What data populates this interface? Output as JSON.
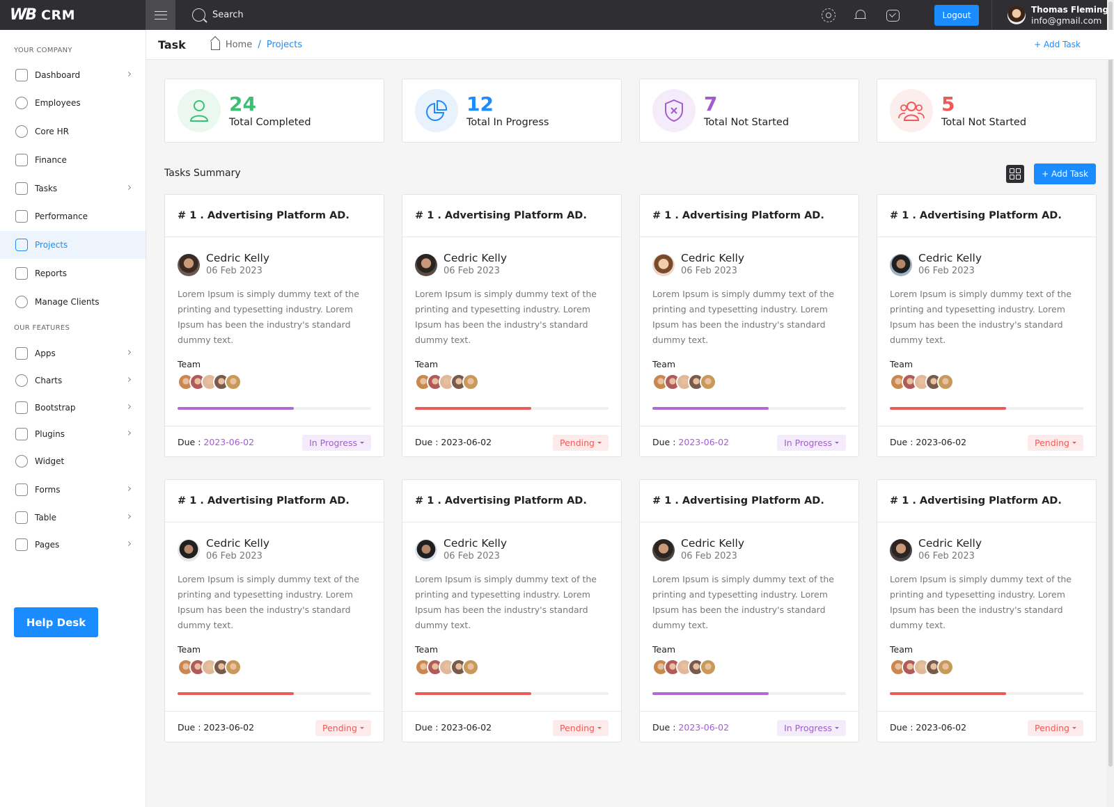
{
  "topbar": {
    "logo_text": "WB",
    "brand": "CRM",
    "search_label": "Search",
    "logout_label": "Logout",
    "user_name": "Thomas Fleming",
    "user_email": "info@gmail.com"
  },
  "sidebar": {
    "section_company": "YOUR COMPANY",
    "section_features": "OUR FEATURES",
    "items": [
      {
        "label": "Dashboard",
        "icon": "home-icon",
        "chevron": true
      },
      {
        "label": "Employees",
        "icon": "user-icon",
        "chevron": false
      },
      {
        "label": "Core HR",
        "icon": "pie-icon",
        "chevron": false
      },
      {
        "label": "Finance",
        "icon": "trend-icon",
        "chevron": false
      },
      {
        "label": "Tasks",
        "icon": "edit-icon",
        "chevron": true
      },
      {
        "label": "Performance",
        "icon": "check-icon",
        "chevron": false
      },
      {
        "label": "Projects",
        "icon": "chart-icon",
        "chevron": false,
        "active": true
      },
      {
        "label": "Reports",
        "icon": "file-icon",
        "chevron": false
      },
      {
        "label": "Manage Clients",
        "icon": "users-icon",
        "chevron": false
      },
      {
        "label": "Apps",
        "icon": "gamepad-icon",
        "chevron": true
      },
      {
        "label": "Charts",
        "icon": "pie-icon",
        "chevron": true
      },
      {
        "label": "Bootstrap",
        "icon": "star-icon",
        "chevron": true
      },
      {
        "label": "Plugins",
        "icon": "folder-icon",
        "chevron": true
      },
      {
        "label": "Widget",
        "icon": "grid-icon",
        "chevron": false
      },
      {
        "label": "Forms",
        "icon": "form-icon",
        "chevron": true
      },
      {
        "label": "Table",
        "icon": "toggle-icon",
        "chevron": true
      },
      {
        "label": "Pages",
        "icon": "image-icon",
        "chevron": true
      }
    ],
    "help_desk": "Help Desk"
  },
  "breadcrumb": {
    "title": "Task",
    "home": "Home",
    "separator": "/",
    "current": "Projects",
    "add_task": "+ Add Task"
  },
  "stats": [
    {
      "value": "24",
      "label": "Total Completed",
      "color": "#3cbf75",
      "bg": "#eaf8f0",
      "icon": "user-icon"
    },
    {
      "value": "12",
      "label": "Total In Progress",
      "color": "#1a8cff",
      "bg": "#e8f2fd",
      "icon": "pie-chart-icon"
    },
    {
      "value": "7",
      "label": "Total Not Started",
      "color": "#a25cd1",
      "bg": "#f4ecfa",
      "icon": "shield-x-icon"
    },
    {
      "value": "5",
      "label": "Total Not Started",
      "color": "#ee5a5a",
      "bg": "#fdeeee",
      "icon": "group-icon"
    }
  ],
  "summary": {
    "title": "Tasks Summary",
    "add_task": "+ Add Task"
  },
  "card_common": {
    "team_label": "Team",
    "due_label": "Due"
  },
  "cards": [
    {
      "title": "# 1 . Advertising Platform AD.",
      "name": "Cedric Kelly",
      "date": "06 Feb 2023",
      "desc": "Lorem Ipsum is simply dummy text of the printing and typesetting industry. Lorem Ipsum has been the industry's standard dummy text.",
      "due": "2023-06-02",
      "status": "In Progress",
      "progress": 60
    },
    {
      "title": "# 1 . Advertising Platform AD.",
      "name": "Cedric Kelly",
      "date": "06 Feb 2023",
      "desc": "Lorem Ipsum is simply dummy text of the printing and typesetting industry. Lorem Ipsum has been the industry's standard dummy text.",
      "due": "2023-06-02",
      "status": "Pending",
      "progress": 60
    },
    {
      "title": "# 1 . Advertising Platform AD.",
      "name": "Cedric Kelly",
      "date": "06 Feb 2023",
      "desc": "Lorem Ipsum is simply dummy text of the printing and typesetting industry. Lorem Ipsum has been the industry's standard dummy text.",
      "due": "2023-06-02",
      "status": "In Progress",
      "progress": 60
    },
    {
      "title": "# 1 . Advertising Platform AD.",
      "name": "Cedric Kelly",
      "date": "06 Feb 2023",
      "desc": "Lorem Ipsum is simply dummy text of the printing and typesetting industry. Lorem Ipsum has been the industry's standard dummy text.",
      "due": "2023-06-02",
      "status": "Pending",
      "progress": 60
    },
    {
      "title": "# 1 . Advertising Platform AD.",
      "name": "Cedric Kelly",
      "date": "06 Feb 2023",
      "desc": "Lorem Ipsum is simply dummy text of the printing and typesetting industry. Lorem Ipsum has been the industry's standard dummy text.",
      "due": "2023-06-02",
      "status": "Pending",
      "progress": 60
    },
    {
      "title": "# 1 . Advertising Platform AD.",
      "name": "Cedric Kelly",
      "date": "06 Feb 2023",
      "desc": "Lorem Ipsum is simply dummy text of the printing and typesetting industry. Lorem Ipsum has been the industry's standard dummy text.",
      "due": "2023-06-02",
      "status": "Pending",
      "progress": 60
    },
    {
      "title": "# 1 . Advertising Platform AD.",
      "name": "Cedric Kelly",
      "date": "06 Feb 2023",
      "desc": "Lorem Ipsum is simply dummy text of the printing and typesetting industry. Lorem Ipsum has been the industry's standard dummy text.",
      "due": "2023-06-02",
      "status": "In Progress",
      "progress": 60
    },
    {
      "title": "# 1 . Advertising Platform AD.",
      "name": "Cedric Kelly",
      "date": "06 Feb 2023",
      "desc": "Lorem Ipsum is simply dummy text of the printing and typesetting industry. Lorem Ipsum has been the industry's standard dummy text.",
      "due": "2023-06-02",
      "status": "Pending",
      "progress": 60
    }
  ],
  "status_colors": {
    "In Progress": {
      "fg": "#a25cd1",
      "bg": "#f4ecfa"
    },
    "Pending": {
      "fg": "#ee5a5a",
      "bg": "#fdeaea"
    }
  }
}
